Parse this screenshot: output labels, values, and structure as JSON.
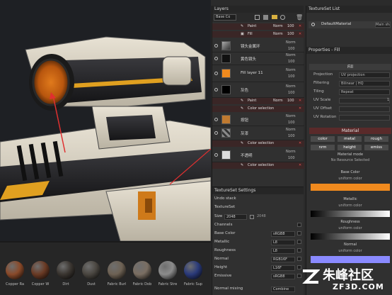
{
  "layers": {
    "title": "Layers",
    "blend_select": "Base Co",
    "top_subs": [
      {
        "label": "Paint",
        "mode": "Norm",
        "opacity": "100"
      },
      {
        "label": "Fill",
        "mode": "Norm",
        "opacity": "100"
      }
    ],
    "rows": [
      {
        "name": "镜头金属环",
        "mode": "Norm",
        "opacity": "100"
      },
      {
        "name": "黄色镜头",
        "mode": "Norm",
        "opacity": "100"
      },
      {
        "name": "Fill layer 11",
        "mode": "Norm",
        "opacity": "100"
      },
      {
        "name": "灰色",
        "mode": "Norm",
        "opacity": "100"
      },
      {
        "name": "按钮",
        "mode": "Norm",
        "opacity": "100"
      },
      {
        "name": "灰漆",
        "mode": "Norm",
        "opacity": "100"
      },
      {
        "name": "不透明",
        "mode": "Norm",
        "opacity": "100"
      }
    ],
    "subs": {
      "s1": {
        "label": "Paint",
        "mode": "Norm",
        "opacity": "100"
      },
      "s2": {
        "label": "Color selection"
      },
      "s3": {
        "label": "Color selection"
      },
      "s4": {
        "label": "Color selection"
      }
    }
  },
  "textureset_list": {
    "title": "TextureSet List",
    "item": "DefaultMaterial",
    "shader": "Main sha"
  },
  "properties": {
    "title": "Properties - Fill",
    "fill_header": "Fill",
    "projection_label": "Projection",
    "projection_value": "UV projection",
    "filtering_label": "Filtering",
    "filtering_value": "Bilinear | HQ",
    "tiling_label": "Tiling",
    "tiling_value": "Repeat",
    "uvscale_label": "UV Scale",
    "uvscale_value": "1",
    "uvoffset_label": "UV Offset",
    "uvrotation_label": "UV Rotation",
    "material_header": "Material",
    "channels": [
      "color",
      "metal",
      "rough",
      "nrm",
      "height",
      "emiss"
    ],
    "material_mode_label": "Material mode",
    "no_resource": "No Resource Selected",
    "base_color_label": "Base Color",
    "uniform_color": "uniform color",
    "metallic_label": "Metallic",
    "roughness_label": "Roughness",
    "normal_label": "Normal",
    "base_color": "#f08a1e",
    "normal_color": "#8a8aff"
  },
  "textureset_settings": {
    "title": "TextureSet Settings",
    "undo_stack": "Undo stack",
    "textureset": "TextureSet",
    "size_label": "Size",
    "size_value": "2048",
    "size_link": "2048",
    "channels_label": "Channels",
    "channels": [
      {
        "name": "Base Color",
        "format": "sRGB8"
      },
      {
        "name": "Metallic",
        "format": "L8"
      },
      {
        "name": "Roughness",
        "format": "L8"
      },
      {
        "name": "Normal",
        "format": "RGB16F"
      },
      {
        "name": "Height",
        "format": "L16F"
      },
      {
        "name": "Emissive",
        "format": "sRGB8"
      }
    ],
    "normal_mixing_label": "Normal mixing",
    "normal_mixing_value": "Combine"
  },
  "shelf": {
    "items": [
      {
        "label": "Copper Ra",
        "color": "#8a4a2a"
      },
      {
        "label": "Copper W",
        "color": "#6a3a24"
      },
      {
        "label": "Dirt",
        "color": "#3a3530"
      },
      {
        "label": "Dust",
        "color": "#4a4640"
      },
      {
        "label": "Fabric Burl",
        "color": "#6e6254"
      },
      {
        "label": "Fabric Dob",
        "color": "#7a6e62"
      },
      {
        "label": "Fabric Stre",
        "color": "#8c8c8c"
      },
      {
        "label": "Fabric Sup",
        "color": "#2a3a7a"
      }
    ]
  },
  "watermark": {
    "brand": "朱峰社区",
    "url": "ZF3D.COM"
  }
}
